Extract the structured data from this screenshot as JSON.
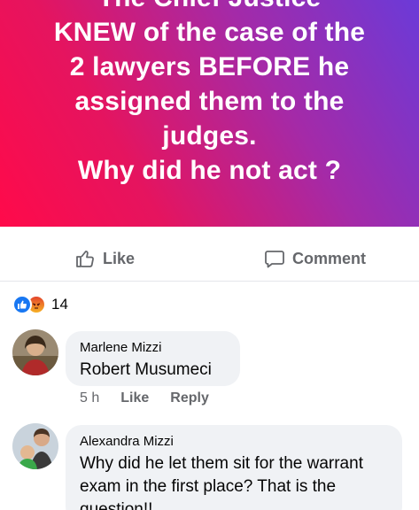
{
  "post": {
    "lines": [
      "The Chief Justice",
      "KNEW of the case of the",
      "2 lawyers BEFORE  he",
      "assigned them to the",
      "judges.",
      "Why did he not act ?"
    ]
  },
  "actions": {
    "like_label": "Like",
    "comment_label": "Comment"
  },
  "reactions": {
    "count": "14",
    "icons": [
      "like-icon",
      "angry-icon"
    ]
  },
  "comments": [
    {
      "author": "Marlene Mizzi",
      "text": "Robert Musumeci",
      "time": "5 h",
      "like_label": "Like",
      "reply_label": "Reply"
    },
    {
      "author": "Alexandra Mizzi",
      "text": "Why did he let them sit for the warrant exam in the first place? That is the question!!"
    }
  ],
  "colors": {
    "gradient_start": "#ff0a4a",
    "gradient_end": "#6b3ad8",
    "secondary_text": "#65676b",
    "bubble": "#f0f2f5",
    "like_blue": "#1877f2"
  }
}
